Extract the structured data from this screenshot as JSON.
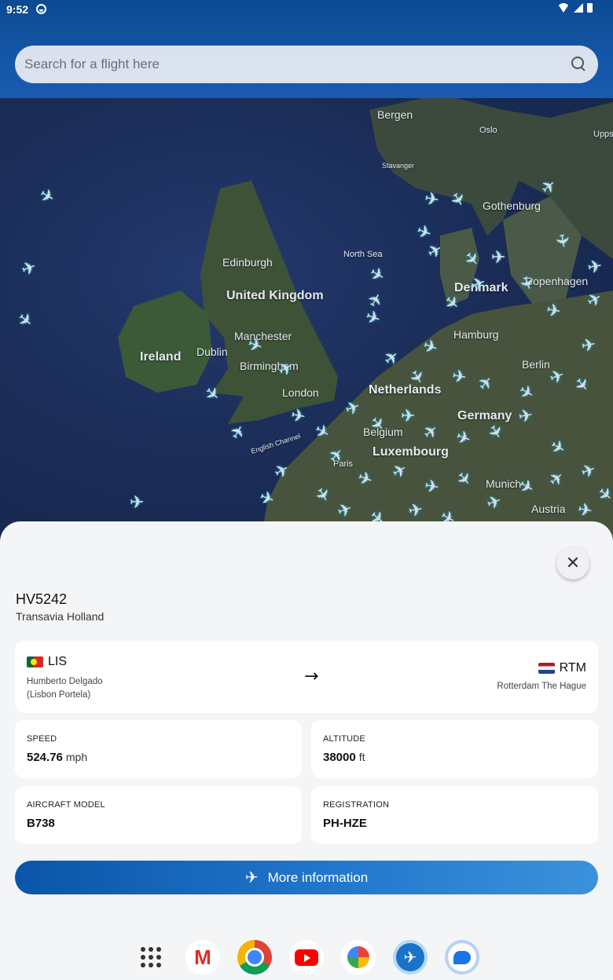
{
  "status_bar": {
    "time": "9:52"
  },
  "search": {
    "placeholder": "Search for a flight here"
  },
  "map": {
    "labels": {
      "bergen": "Bergen",
      "oslo": "Oslo",
      "upps": "Upps",
      "stavanger": "Stavanger",
      "gothenburg": "Gothenburg",
      "north_sea": "North Sea",
      "edinburgh": "Edinburgh",
      "united_kingdom": "United Kingdom",
      "denmark": "Denmark",
      "copenhagen": "Copenhagen",
      "ireland": "Ireland",
      "dublin": "Dublin",
      "manchester": "Manchester",
      "hamburg": "Hamburg",
      "birmingham": "Birmingham",
      "berlin": "Berlin",
      "netherlands": "Netherlands",
      "london": "London",
      "germany": "Germany",
      "belgium": "Belgium",
      "english_channel": "English Channel",
      "luxembourg": "Luxembourg",
      "paris": "Paris",
      "munich": "Munich",
      "austria": "Austria"
    }
  },
  "flight": {
    "number": "HV5242",
    "airline": "Transavia Holland",
    "departure": {
      "code": "LIS",
      "name": "Humberto Delgado (Lisbon Portela)",
      "flag": "portugal-flag"
    },
    "arrival": {
      "code": "RTM",
      "name": "Rotterdam The Hague",
      "flag": "netherlands-flag"
    },
    "speed": {
      "label": "SPEED",
      "value": "524.76",
      "unit": "mph"
    },
    "altitude": {
      "label": "ALTITUDE",
      "value": "38000",
      "unit": "ft"
    },
    "model": {
      "label": "AIRCRAFT MODEL",
      "value": "B738"
    },
    "registration": {
      "label": "REGISTRATION",
      "value": "PH-HZE"
    }
  },
  "actions": {
    "more_info": "More information"
  },
  "dock": [
    "app-drawer-icon",
    "gmail-icon",
    "chrome-icon",
    "youtube-icon",
    "photos-icon",
    "flight-tracker-icon",
    "messages-icon"
  ],
  "colors": {
    "accent": "#1565c0",
    "sheet_bg": "#f4f5f7",
    "plane_glow": "#1ab3c8"
  }
}
